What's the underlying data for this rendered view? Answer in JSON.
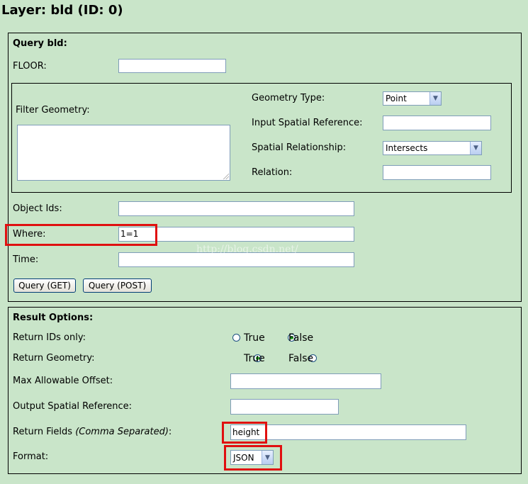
{
  "page_title": "Layer: bld (ID: 0)",
  "query": {
    "heading": "Query bld:",
    "floor_label": "FLOOR:",
    "floor_value": "",
    "filter_geometry_label": "Filter Geometry:",
    "geometry_type_label": "Geometry Type:",
    "geometry_type_value": "Point",
    "input_sr_label": "Input Spatial Reference:",
    "spatial_rel_label": "Spatial Relationship:",
    "spatial_rel_value": "Intersects",
    "relation_label": "Relation:",
    "object_ids_label": "Object Ids:",
    "where_label": "Where:",
    "where_value": "1=1",
    "time_label": "Time:",
    "query_get_label": "Query (GET)",
    "query_post_label": "Query (POST)"
  },
  "result": {
    "heading": "Result Options:",
    "ids_only_label": "Return IDs only:",
    "return_geometry_label": "Return Geometry:",
    "true_label": "True",
    "false_label": "False",
    "ids_only_value": "False",
    "return_geometry_value": "True",
    "max_offset_label": "Max Allowable Offset:",
    "output_sr_label": "Output Spatial Reference:",
    "return_fields_label": "Return Fields ",
    "return_fields_note": "(Comma Separated)",
    "return_fields_colon": ":",
    "return_fields_value": "height",
    "format_label": "Format:",
    "format_value": "JSON"
  },
  "watermark": "http://blog.csdn.net/",
  "icons": {
    "dropdown": "chevron-down-icon",
    "radio": "radio-button-icon",
    "resize": "resize-grip-icon"
  },
  "colors": {
    "background": "#c9e5c9",
    "highlight": "#e01010"
  }
}
